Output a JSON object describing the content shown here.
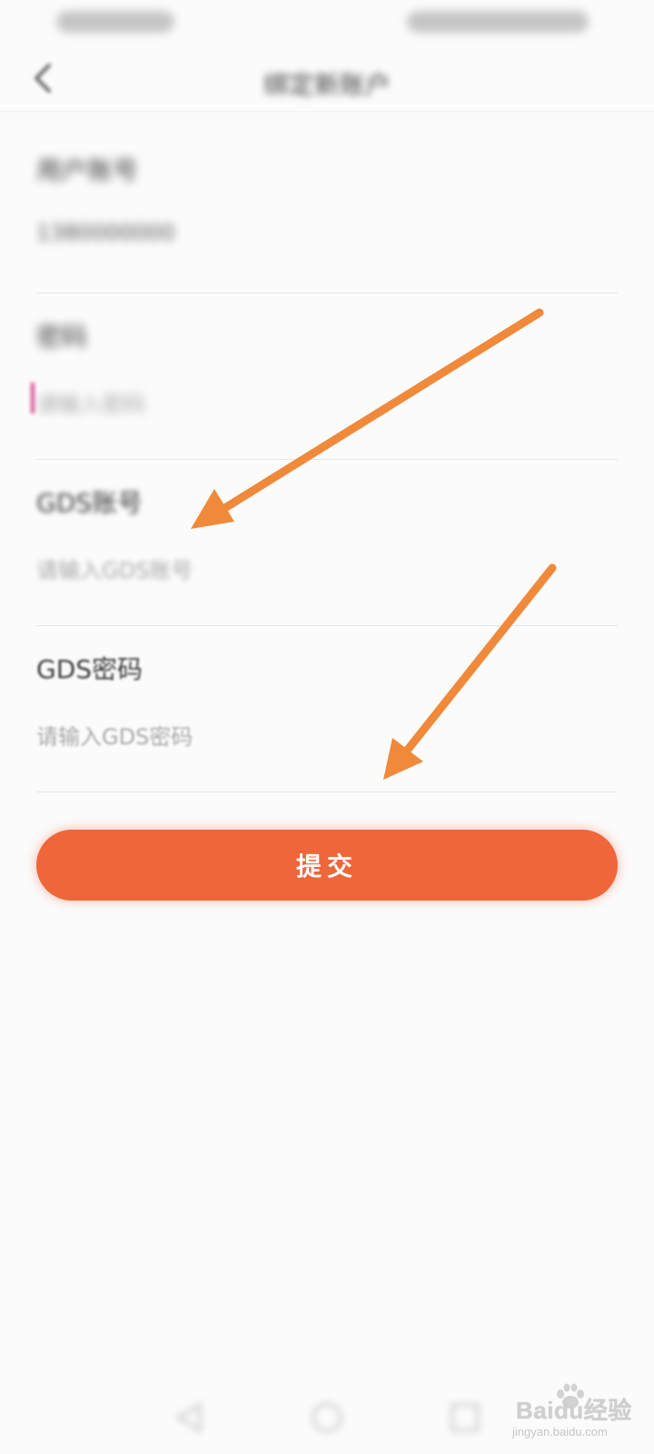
{
  "header": {
    "title": "绑定新账户"
  },
  "form": {
    "fields": [
      {
        "label": "用户账号",
        "value": "1380000000",
        "placeholder": ""
      },
      {
        "label": "密码",
        "value": "",
        "placeholder": "请输入密码"
      },
      {
        "label": "GDS账号",
        "value": "",
        "placeholder": "请输入GDS账号"
      },
      {
        "label": "GDS密码",
        "value": "",
        "placeholder": "请输入GDS密码"
      }
    ]
  },
  "submit": {
    "label": "提交"
  },
  "watermark": {
    "brand": "Baidu经验",
    "site": "jingyan.baidu.com"
  },
  "colors": {
    "accent": "#ee6639",
    "annotation_arrow": "#f0893a",
    "background": "#fbfbfb"
  },
  "icons": {
    "back": "chevron-left-icon",
    "annotation": "arrow-icon",
    "nav": [
      "triangle-back-icon",
      "circle-home-icon",
      "square-recents-icon"
    ]
  }
}
